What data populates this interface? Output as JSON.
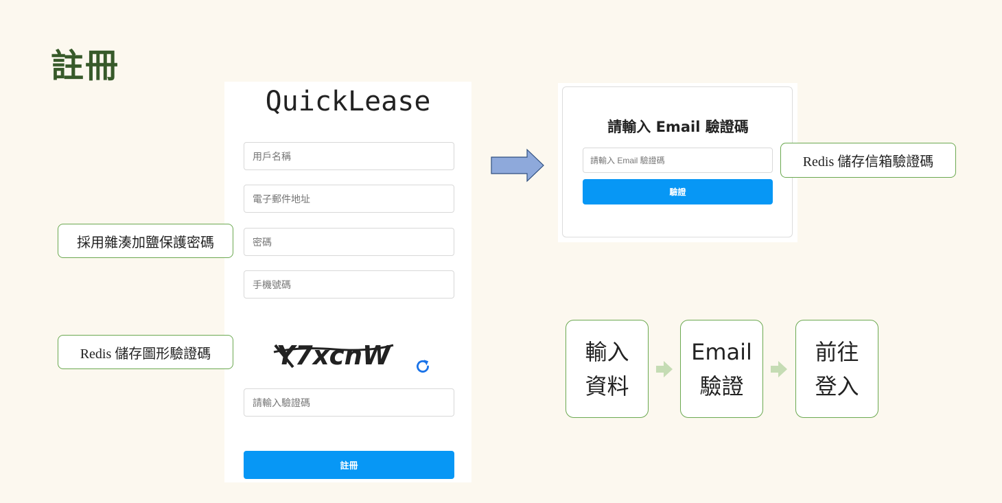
{
  "slide": {
    "title": "註冊"
  },
  "registration": {
    "brand": "QuickLease",
    "username_placeholder": "用戶名稱",
    "email_placeholder": "電子郵件地址",
    "password_placeholder": "密碼",
    "phone_placeholder": "手機號碼",
    "captcha_text": "Y7xcnW",
    "captcha_placeholder": "請輸入驗證碼",
    "submit_label": "註冊"
  },
  "verification": {
    "title": "請輸入 Email 驗證碼",
    "code_placeholder": "請輸入 Email 驗證碼",
    "verify_label": "驗證"
  },
  "notes": {
    "password_hash": "採用雜湊加鹽保護密碼",
    "captcha_redis": "Redis 儲存圖形驗證碼",
    "email_code_redis": "Redis 儲存信箱驗證碼"
  },
  "flow": {
    "steps": [
      {
        "line1": "輸入",
        "line2": "資料"
      },
      {
        "line1": "Email",
        "line2": "驗證"
      },
      {
        "line1": "前往",
        "line2": "登入"
      }
    ]
  },
  "colors": {
    "background": "#fcf8ef",
    "title": "#375a2a",
    "button": "#0797f5",
    "note_border": "#6aa84f",
    "blue_arrow": "#8ea9db",
    "green_arrow": "#c5dcb4"
  }
}
